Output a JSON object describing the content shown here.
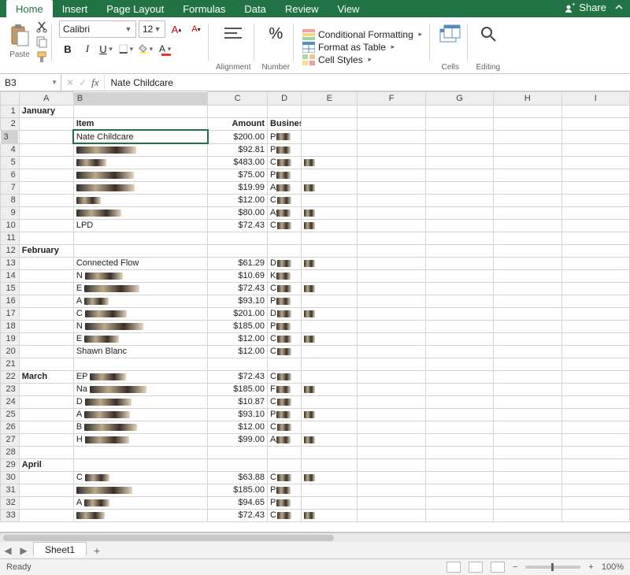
{
  "tabs": [
    "Home",
    "Insert",
    "Page Layout",
    "Formulas",
    "Data",
    "Review",
    "View"
  ],
  "active_tab": "Home",
  "share_label": "Share",
  "ribbon": {
    "paste": "Paste",
    "font_name": "Calibri",
    "font_size": "12",
    "alignment": "Alignment",
    "number": "Number",
    "cond_formatting": "Conditional Formatting",
    "format_table": "Format as Table",
    "cell_styles": "Cell Styles",
    "cells": "Cells",
    "editing": "Editing"
  },
  "namebox": "B3",
  "formula_value": "Nate Childcare",
  "columns": [
    "A",
    "B",
    "C",
    "D",
    "E",
    "F",
    "G",
    "H",
    "I"
  ],
  "headers": {
    "item": "Item",
    "amount": "Amount",
    "business": "Business"
  },
  "months": {
    "jan": "January",
    "feb": "February",
    "mar": "March",
    "apr": "April"
  },
  "rows": [
    {
      "n": 1,
      "a": "January"
    },
    {
      "n": 2,
      "b_hdr": true
    },
    {
      "n": 3,
      "b": "Nate Childcare",
      "c": "$200.00",
      "d": "P",
      "sel": true
    },
    {
      "n": 4,
      "b": "",
      "c": "$92.81",
      "d": "P"
    },
    {
      "n": 5,
      "b": "",
      "c": "$483.00",
      "d": "C",
      "e": true
    },
    {
      "n": 6,
      "b": "",
      "c": "$75.00",
      "d": "P"
    },
    {
      "n": 7,
      "b": "",
      "c": "$19.99",
      "d": "A",
      "e": true
    },
    {
      "n": 8,
      "b": "",
      "c": "$12.00",
      "d": "C"
    },
    {
      "n": 9,
      "b": "",
      "c": "$80.00",
      "d": "A",
      "e": true
    },
    {
      "n": 10,
      "b": "LPD",
      "c": "$72.43",
      "d": "C",
      "e": true
    },
    {
      "n": 11
    },
    {
      "n": 12,
      "a": "February"
    },
    {
      "n": 13,
      "b": "Connected Flow",
      "c": "$61.29",
      "d": "D",
      "e": true
    },
    {
      "n": 14,
      "b": "N",
      "c": "$10.69",
      "d": "K"
    },
    {
      "n": 15,
      "b": "E",
      "c": "$72.43",
      "d": "C",
      "e": true
    },
    {
      "n": 16,
      "b": "A",
      "c": "$93.10",
      "d": "P"
    },
    {
      "n": 17,
      "b": "C",
      "c": "$201.00",
      "d": "D",
      "e": true
    },
    {
      "n": 18,
      "b": "N",
      "c": "$185.00",
      "d": "P"
    },
    {
      "n": 19,
      "b": "E",
      "c": "$12.00",
      "d": "C",
      "e": true
    },
    {
      "n": 20,
      "b": "Shawn Blanc",
      "c": "$12.00",
      "d": "C"
    },
    {
      "n": 21
    },
    {
      "n": 22,
      "a": "March",
      "b": "EP",
      "c": "$72.43",
      "d": "C"
    },
    {
      "n": 23,
      "b": "Na",
      "c": "$185.00",
      "d": "F",
      "e": true
    },
    {
      "n": 24,
      "b": "D",
      "c": "$10.87",
      "d": "C"
    },
    {
      "n": 25,
      "b": "A",
      "c": "$93.10",
      "d": "P",
      "e": true
    },
    {
      "n": 26,
      "b": "B",
      "c": "$12.00",
      "d": "C"
    },
    {
      "n": 27,
      "b": "H",
      "c": "$99.00",
      "d": "A",
      "e": true
    },
    {
      "n": 28
    },
    {
      "n": 29,
      "a": "April"
    },
    {
      "n": 30,
      "b": "C",
      "c": "$63.88",
      "d": "C",
      "e": true
    },
    {
      "n": 31,
      "b": "",
      "c": "$185.00",
      "d": "P"
    },
    {
      "n": 32,
      "b": "A",
      "c": "$94.65",
      "d": "P"
    },
    {
      "n": 33,
      "b": "",
      "c": "$72.43",
      "d": "C",
      "e": true
    }
  ],
  "sheet_name": "Sheet1",
  "status_text": "Ready",
  "zoom": "100%"
}
